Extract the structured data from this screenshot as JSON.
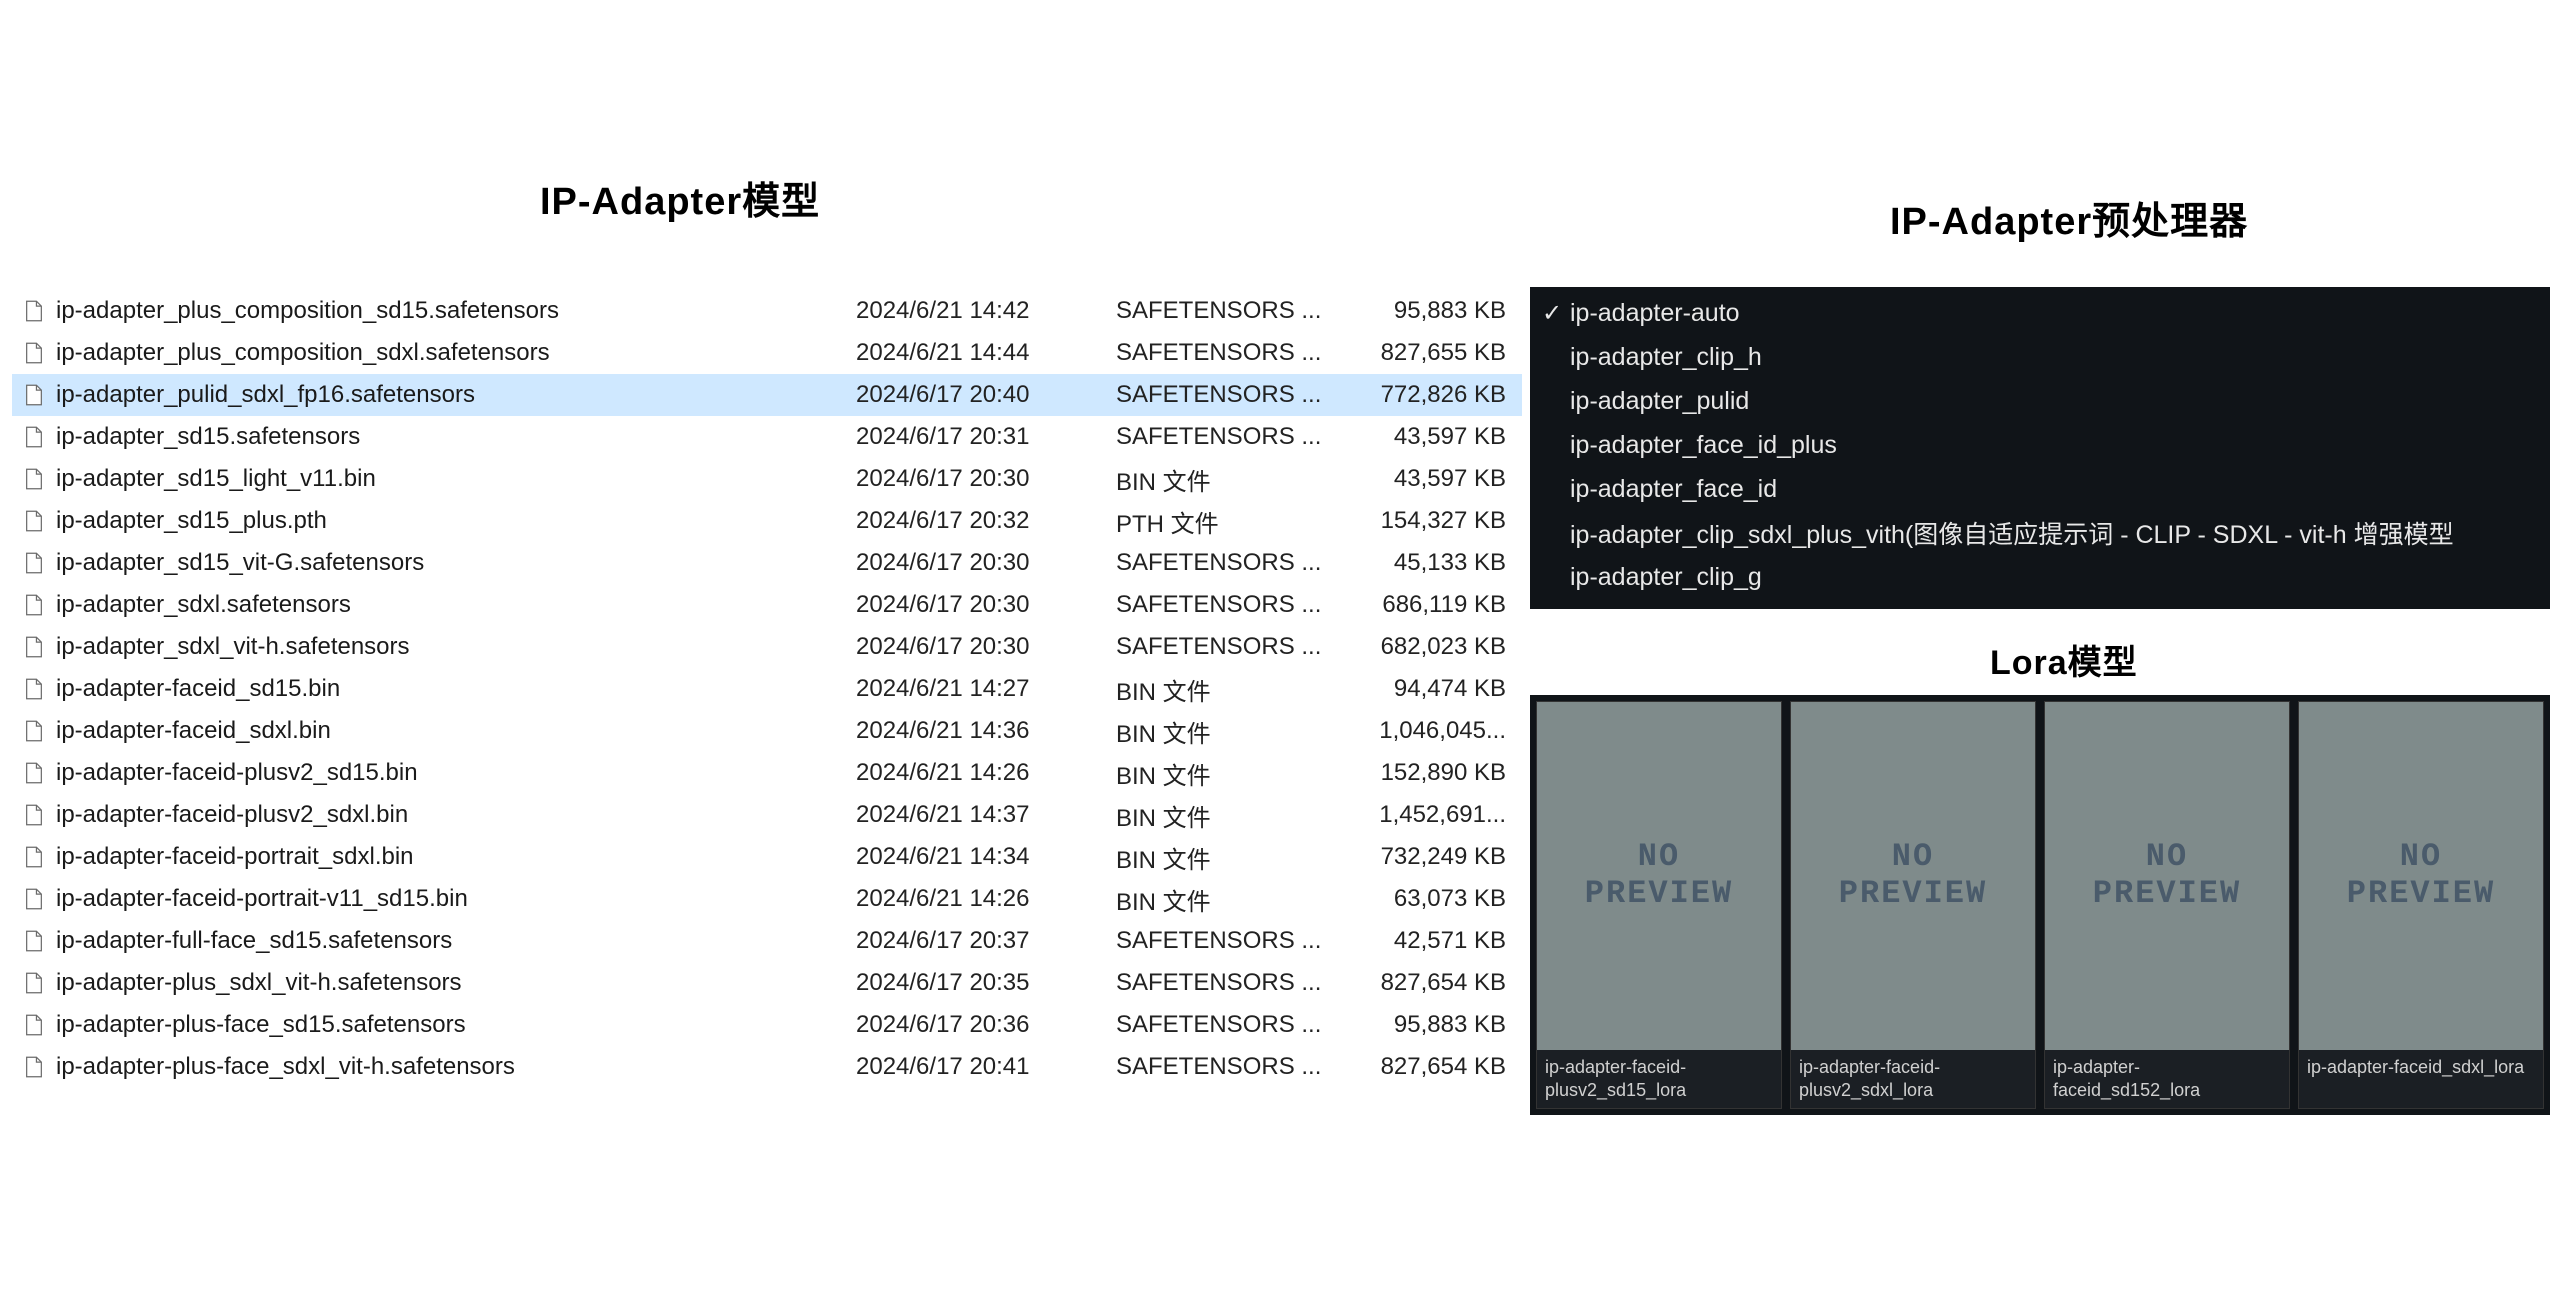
{
  "headings": {
    "models": "IP-Adapter模型",
    "preprocessors": "IP-Adapter预处理器",
    "lora": "Lora模型"
  },
  "files": [
    {
      "name": "ip-adapter_plus_composition_sd15.safetensors",
      "date": "2024/6/21 14:42",
      "type": "SAFETENSORS ...",
      "size": "95,883 KB",
      "selected": false
    },
    {
      "name": "ip-adapter_plus_composition_sdxl.safetensors",
      "date": "2024/6/21 14:44",
      "type": "SAFETENSORS ...",
      "size": "827,655 KB",
      "selected": false
    },
    {
      "name": "ip-adapter_pulid_sdxl_fp16.safetensors",
      "date": "2024/6/17 20:40",
      "type": "SAFETENSORS ...",
      "size": "772,826 KB",
      "selected": true
    },
    {
      "name": "ip-adapter_sd15.safetensors",
      "date": "2024/6/17 20:31",
      "type": "SAFETENSORS ...",
      "size": "43,597 KB",
      "selected": false
    },
    {
      "name": "ip-adapter_sd15_light_v11.bin",
      "date": "2024/6/17 20:30",
      "type": "BIN 文件",
      "size": "43,597 KB",
      "selected": false
    },
    {
      "name": "ip-adapter_sd15_plus.pth",
      "date": "2024/6/17 20:32",
      "type": "PTH 文件",
      "size": "154,327 KB",
      "selected": false
    },
    {
      "name": "ip-adapter_sd15_vit-G.safetensors",
      "date": "2024/6/17 20:30",
      "type": "SAFETENSORS ...",
      "size": "45,133 KB",
      "selected": false
    },
    {
      "name": "ip-adapter_sdxl.safetensors",
      "date": "2024/6/17 20:30",
      "type": "SAFETENSORS ...",
      "size": "686,119 KB",
      "selected": false
    },
    {
      "name": "ip-adapter_sdxl_vit-h.safetensors",
      "date": "2024/6/17 20:30",
      "type": "SAFETENSORS ...",
      "size": "682,023 KB",
      "selected": false
    },
    {
      "name": "ip-adapter-faceid_sd15.bin",
      "date": "2024/6/21 14:27",
      "type": "BIN 文件",
      "size": "94,474 KB",
      "selected": false
    },
    {
      "name": "ip-adapter-faceid_sdxl.bin",
      "date": "2024/6/21 14:36",
      "type": "BIN 文件",
      "size": "1,046,045...",
      "selected": false
    },
    {
      "name": "ip-adapter-faceid-plusv2_sd15.bin",
      "date": "2024/6/21 14:26",
      "type": "BIN 文件",
      "size": "152,890 KB",
      "selected": false
    },
    {
      "name": "ip-adapter-faceid-plusv2_sdxl.bin",
      "date": "2024/6/21 14:37",
      "type": "BIN 文件",
      "size": "1,452,691...",
      "selected": false
    },
    {
      "name": "ip-adapter-faceid-portrait_sdxl.bin",
      "date": "2024/6/21 14:34",
      "type": "BIN 文件",
      "size": "732,249 KB",
      "selected": false
    },
    {
      "name": "ip-adapter-faceid-portrait-v11_sd15.bin",
      "date": "2024/6/21 14:26",
      "type": "BIN 文件",
      "size": "63,073 KB",
      "selected": false
    },
    {
      "name": "ip-adapter-full-face_sd15.safetensors",
      "date": "2024/6/17 20:37",
      "type": "SAFETENSORS ...",
      "size": "42,571 KB",
      "selected": false
    },
    {
      "name": "ip-adapter-plus_sdxl_vit-h.safetensors",
      "date": "2024/6/17 20:35",
      "type": "SAFETENSORS ...",
      "size": "827,654 KB",
      "selected": false
    },
    {
      "name": "ip-adapter-plus-face_sd15.safetensors",
      "date": "2024/6/17 20:36",
      "type": "SAFETENSORS ...",
      "size": "95,883 KB",
      "selected": false
    },
    {
      "name": "ip-adapter-plus-face_sdxl_vit-h.safetensors",
      "date": "2024/6/17 20:41",
      "type": "SAFETENSORS ...",
      "size": "827,654 KB",
      "selected": false
    }
  ],
  "preprocessors": [
    {
      "label": "ip-adapter-auto",
      "checked": true
    },
    {
      "label": "ip-adapter_clip_h",
      "checked": false
    },
    {
      "label": "ip-adapter_pulid",
      "checked": false
    },
    {
      "label": "ip-adapter_face_id_plus",
      "checked": false
    },
    {
      "label": "ip-adapter_face_id",
      "checked": false
    },
    {
      "label": "ip-adapter_clip_sdxl_plus_vith(图像自适应提示词 - CLIP - SDXL - vit-h 增强模型",
      "checked": false
    },
    {
      "label": "ip-adapter_clip_g",
      "checked": false
    }
  ],
  "lora_cards": [
    {
      "label": "ip-adapter-faceid-plusv2_sd15_lora",
      "preview": "NO\nPREVIEW"
    },
    {
      "label": "ip-adapter-faceid-plusv2_sdxl_lora",
      "preview": "NO\nPREVIEW"
    },
    {
      "label": "ip-adapter-faceid_sd152_lora",
      "preview": "NO\nPREVIEW"
    },
    {
      "label": "ip-adapter-faceid_sdxl_lora",
      "preview": "NO\nPREVIEW"
    }
  ]
}
